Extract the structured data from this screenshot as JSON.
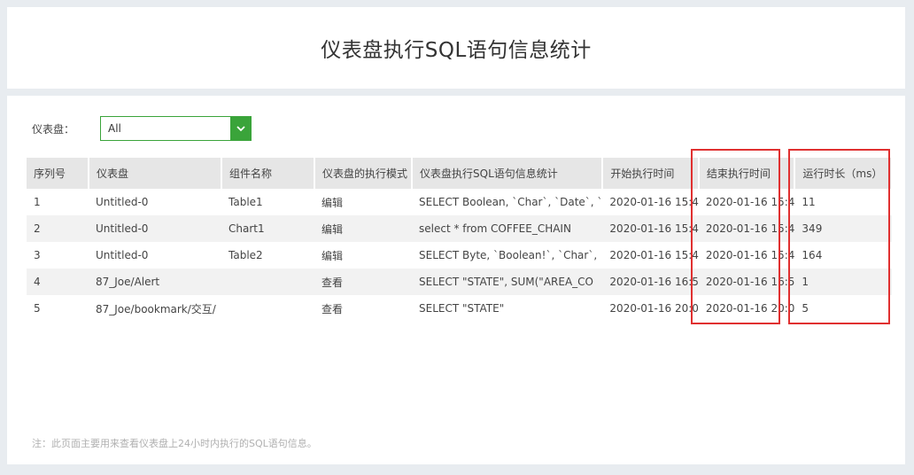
{
  "page": {
    "title": "仪表盘执行SQL语句信息统计"
  },
  "filter": {
    "label": "仪表盘：",
    "value": "All"
  },
  "table": {
    "headers": [
      "序列号",
      "仪表盘",
      "组件名称",
      "仪表盘的执行模式",
      "仪表盘执行SQL语句信息统计",
      "开始执行时间",
      "结束执行时间",
      "运行时长（ms）"
    ],
    "rows": [
      [
        "1",
        "Untitled-0",
        "Table1",
        "编辑",
        "SELECT  Boolean,  `Char`,  `Date`,  `",
        "2020-01-16 15:4",
        "2020-01-16 15:4",
        "11"
      ],
      [
        "2",
        "Untitled-0",
        "Chart1",
        "编辑",
        "select * from COFFEE_CHAIN",
        "2020-01-16 15:4",
        "2020-01-16 15:4",
        "349"
      ],
      [
        "3",
        "Untitled-0",
        "Table2",
        "编辑",
        "SELECT  Byte,  `Boolean!`,  `Char`,",
        "2020-01-16 15:4",
        "2020-01-16 15:4",
        "164"
      ],
      [
        "4",
        "87_Joe/Alert",
        "",
        "查看",
        "SELECT  \"STATE\", SUM(\"AREA_CO",
        "2020-01-16 16:5",
        "2020-01-16 16:5",
        "1"
      ],
      [
        "5",
        "87_Joe/bookmark/交互/",
        "",
        "查看",
        "SELECT  \"STATE\"",
        "2020-01-16 20:0",
        "2020-01-16 20:0",
        "5"
      ]
    ]
  },
  "note": "注：此页面主要用来查看仪表盘上24小时内执行的SQL语句信息。",
  "colors": {
    "accent": "#3aa43a",
    "highlight": "#e03030"
  }
}
